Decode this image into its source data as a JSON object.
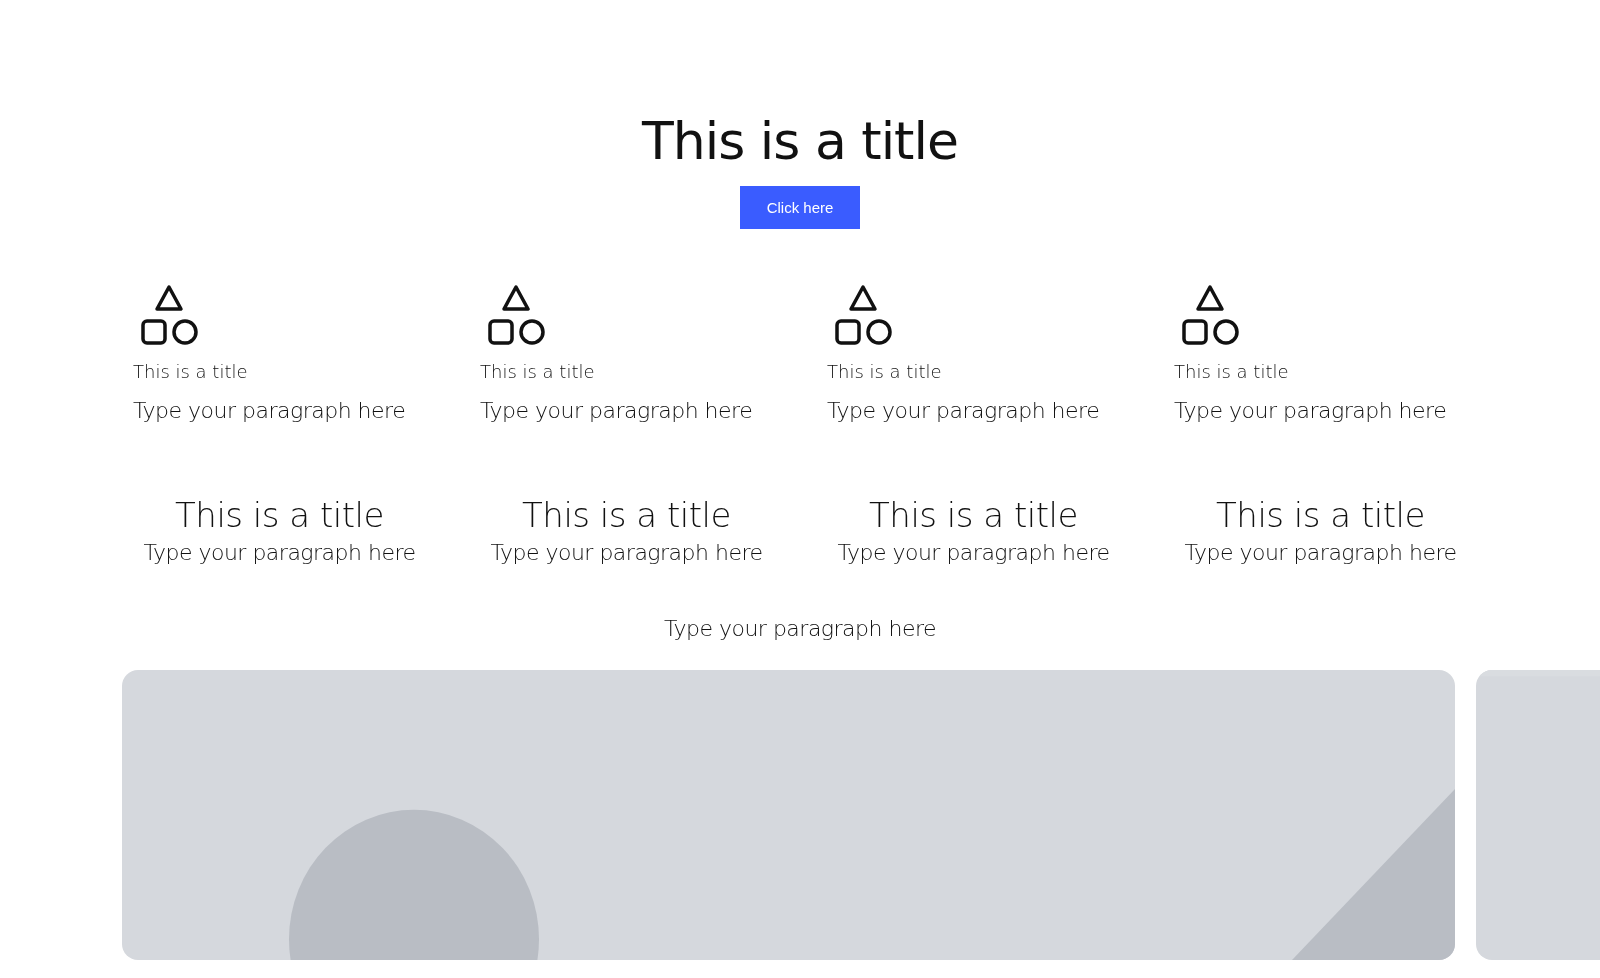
{
  "hero": {
    "title": "This is a title",
    "button": "Click here"
  },
  "features": [
    {
      "title": "This is a title",
      "paragraph": "Type your paragraph here"
    },
    {
      "title": "This is a title",
      "paragraph": "Type your paragraph here"
    },
    {
      "title": "This is a title",
      "paragraph": "Type your paragraph here"
    },
    {
      "title": "This is a title",
      "paragraph": "Type your paragraph here"
    }
  ],
  "cards": [
    {
      "title": "This is a title",
      "paragraph": "Type your paragraph here"
    },
    {
      "title": "This is a title",
      "paragraph": "Type your paragraph here"
    },
    {
      "title": "This is a title",
      "paragraph": "Type your paragraph here"
    },
    {
      "title": "This is a title",
      "paragraph": "Type your paragraph here"
    }
  ],
  "paragraph": "Type your paragraph here"
}
